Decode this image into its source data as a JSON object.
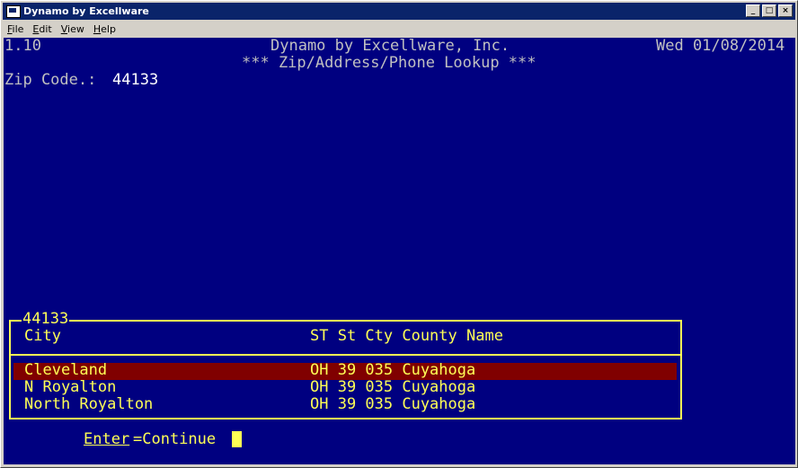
{
  "window": {
    "title": "Dynamo by Excellware"
  },
  "menu": [
    {
      "label": "File",
      "accel": "F",
      "rest": "ile"
    },
    {
      "label": "Edit",
      "accel": "E",
      "rest": "dit"
    },
    {
      "label": "View",
      "accel": "V",
      "rest": "iew"
    },
    {
      "label": "Help",
      "accel": "H",
      "rest": "elp"
    }
  ],
  "header": {
    "version": "1.10",
    "company": "Dynamo by Excellware, Inc.",
    "date": "Wed 01/08/2014",
    "subtitle": "*** Zip/Address/Phone Lookup ***"
  },
  "zip_field": {
    "label": "Zip Code.:",
    "value": "44133"
  },
  "lookup": {
    "box_title": "44133",
    "columns": {
      "city": "City",
      "rest": "ST St Cty County Name"
    },
    "rows": [
      {
        "city": "Cleveland",
        "rest": "OH 39 035 Cuyahoga",
        "selected": true
      },
      {
        "city": "N Royalton",
        "rest": "OH 39 035 Cuyahoga",
        "selected": false
      },
      {
        "city": "North Royalton",
        "rest": "OH 39 035 Cuyahoga",
        "selected": false
      }
    ]
  },
  "footer": {
    "key": "Enter",
    "action": "=Continue"
  },
  "colors": {
    "background": "#000080",
    "text": "#c0c0c0",
    "highlight": "#ffff55",
    "selection": "#800000"
  }
}
